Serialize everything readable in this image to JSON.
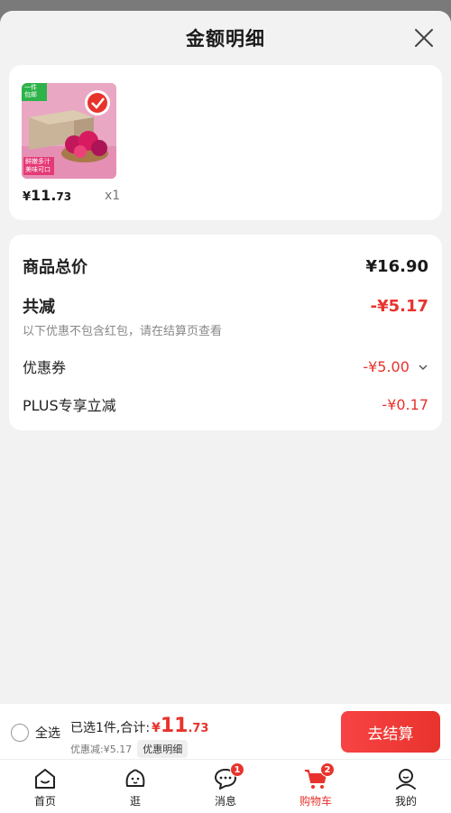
{
  "header": {
    "title": "金额明细"
  },
  "product": {
    "image_tag_line1": "一件",
    "image_tag_line2": "包邮",
    "image_caption_line1": "鲜嫩多汁",
    "image_caption_line2": "美味可口",
    "price_symbol": "¥",
    "price_int": "11.",
    "price_dec": "73",
    "quantity": "x1"
  },
  "detail": {
    "total_label": "商品总价",
    "total_value": "¥16.90",
    "reduce_label": "共减",
    "reduce_value": "-¥5.17",
    "note": "以下优惠不包含红包，请在结算页查看",
    "coupon_label": "优惠券",
    "coupon_value": "-¥5.00",
    "plus_label": "PLUS专享立减",
    "plus_value": "-¥0.17"
  },
  "bottom_bar": {
    "select_all": "全选",
    "selected_text": "已选1件,合计:",
    "total_symbol": "¥",
    "total_int": "11",
    "total_dec": ".73",
    "discount_text": "优惠减:¥5.17",
    "detail_chip": "优惠明细",
    "checkout_label": "去结算"
  },
  "tabbar": {
    "tabs": [
      {
        "label": "首页",
        "icon": "home-icon"
      },
      {
        "label": "逛",
        "icon": "browse-icon"
      },
      {
        "label": "消息",
        "icon": "message-icon",
        "badge": "1"
      },
      {
        "label": "购物车",
        "icon": "cart-icon",
        "badge": "2",
        "active": true
      },
      {
        "label": "我的",
        "icon": "profile-icon"
      }
    ]
  },
  "colors": {
    "accent": "#e8332d",
    "background": "#f2f2f2",
    "card": "#ffffff"
  }
}
